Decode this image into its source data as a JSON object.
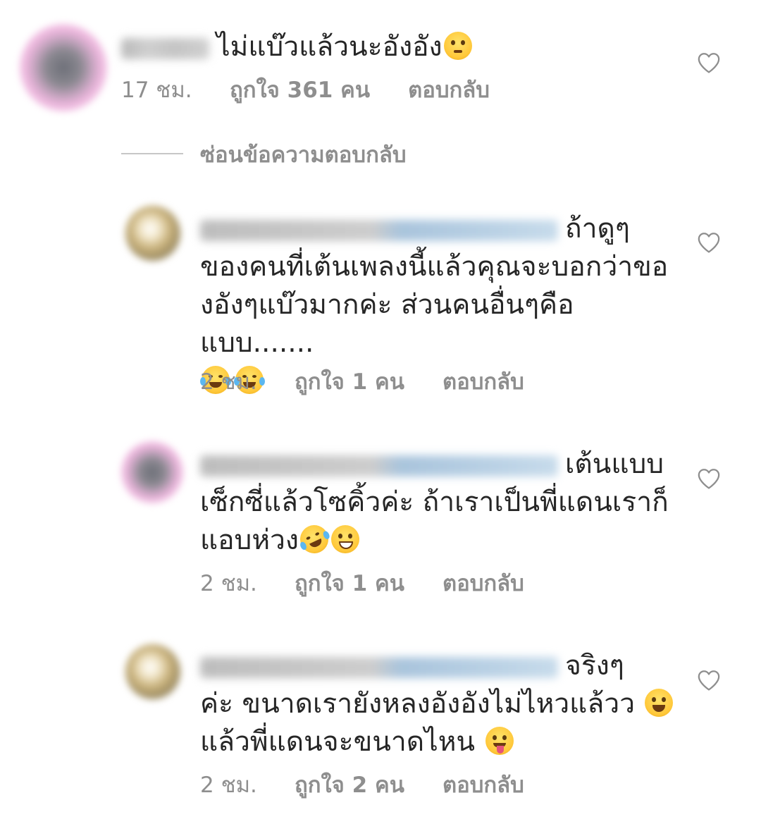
{
  "comments": [
    {
      "text": "ไม่แบ๊วแล้วนะอังอัง",
      "emojis": [
        "pleading-face"
      ],
      "time": "17 ชม.",
      "likes": "ถูกใจ 361 คน",
      "reply": "ตอบกลับ"
    }
  ],
  "hide_replies_label": "ซ่อนข้อความตอบกลับ",
  "replies": [
    {
      "first_line": "ถ้าดูๆ",
      "lines": [
        "ของคนที่เต้นเพลงนี้แล้วคุณจะบอกว่าขอ",
        "งอังๆแบ๊วมากค่ะ ส่วนคนอื่นๆคือแบบ......."
      ],
      "emojis": [
        "joy",
        "joy"
      ],
      "time": "2 ชม.",
      "likes": "ถูกใจ 1 คน",
      "reply": "ตอบกลับ"
    },
    {
      "first_line": "เต้นแบบ",
      "lines": [
        "เซ็กซี่แล้วโซคิ้วค่ะ ถ้าเราเป็นพี่แดนเราก็",
        "แอบห่วง"
      ],
      "emojis": [
        "rofl",
        "grin"
      ],
      "time": "2 ชม.",
      "likes": "ถูกใจ 1 คน",
      "reply": "ตอบกลับ"
    },
    {
      "first_line": "จริงๆ",
      "lines": [
        "ค่ะ ขนาดเรายังหลงอังอังไม่ไหวแล้วว",
        "แล้วพี่แดนจะขนาดไหน"
      ],
      "emojis": [
        "laughing",
        "zany"
      ],
      "time": "2 ชม.",
      "likes": "ถูกใจ 2 คน",
      "reply": "ตอบกลับ"
    }
  ],
  "colors": {
    "text": "#262626",
    "secondary": "#8e8e8e",
    "heart_outline": "#8e8e8e"
  }
}
